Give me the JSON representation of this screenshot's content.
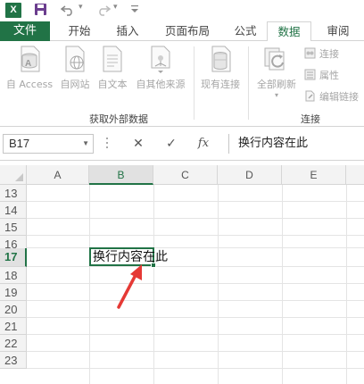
{
  "quick_access": {
    "app_icon": "excel-logo-icon",
    "app_letter": "X",
    "icons": [
      "save-icon",
      "undo-icon",
      "redo-icon",
      "customize-icon"
    ]
  },
  "ribbon_tabs": [
    {
      "label": "文件",
      "active": false
    },
    {
      "label": "开始",
      "active": false
    },
    {
      "label": "插入",
      "active": false
    },
    {
      "label": "页面布局",
      "active": false
    },
    {
      "label": "公式",
      "active": false
    },
    {
      "label": "数据",
      "active": true
    },
    {
      "label": "审阅",
      "active": false
    }
  ],
  "ribbon": {
    "get_external_data": {
      "buttons": [
        {
          "label": "自 Access",
          "icon": "access-database-icon"
        },
        {
          "label": "自网站",
          "icon": "web-globe-icon"
        },
        {
          "label": "自文本",
          "icon": "text-file-icon"
        },
        {
          "label": "自其他来源",
          "icon": "other-sources-icon"
        }
      ],
      "group_label": "获取外部数据"
    },
    "existing_connections": {
      "label": "现有连接",
      "icon": "existing-connections-icon"
    },
    "connections": {
      "refresh_all": {
        "label": "全部刷新",
        "icon": "refresh-all-icon"
      },
      "small_buttons": [
        {
          "label": "连接",
          "icon": "connections-icon"
        },
        {
          "label": "属性",
          "icon": "properties-icon"
        },
        {
          "label": "编辑链接",
          "icon": "edit-links-icon"
        }
      ],
      "group_label": "连接"
    }
  },
  "formula_bar": {
    "name_box": "B17",
    "cancel_symbol": "✕",
    "enter_symbol": "✓",
    "fx_symbol": "fx",
    "content": "换行内容在此"
  },
  "sheet": {
    "columns": [
      "A",
      "B",
      "C",
      "D",
      "E"
    ],
    "selected_column": "B",
    "rows": [
      "13",
      "14",
      "15",
      "16",
      "17",
      "18",
      "19",
      "20",
      "21",
      "22",
      "23"
    ],
    "selected_row": "17",
    "active_cell": {
      "ref": "B17",
      "value": "换行内容在此"
    },
    "accent_color": "#217346",
    "annotation_color": "#e53935"
  }
}
